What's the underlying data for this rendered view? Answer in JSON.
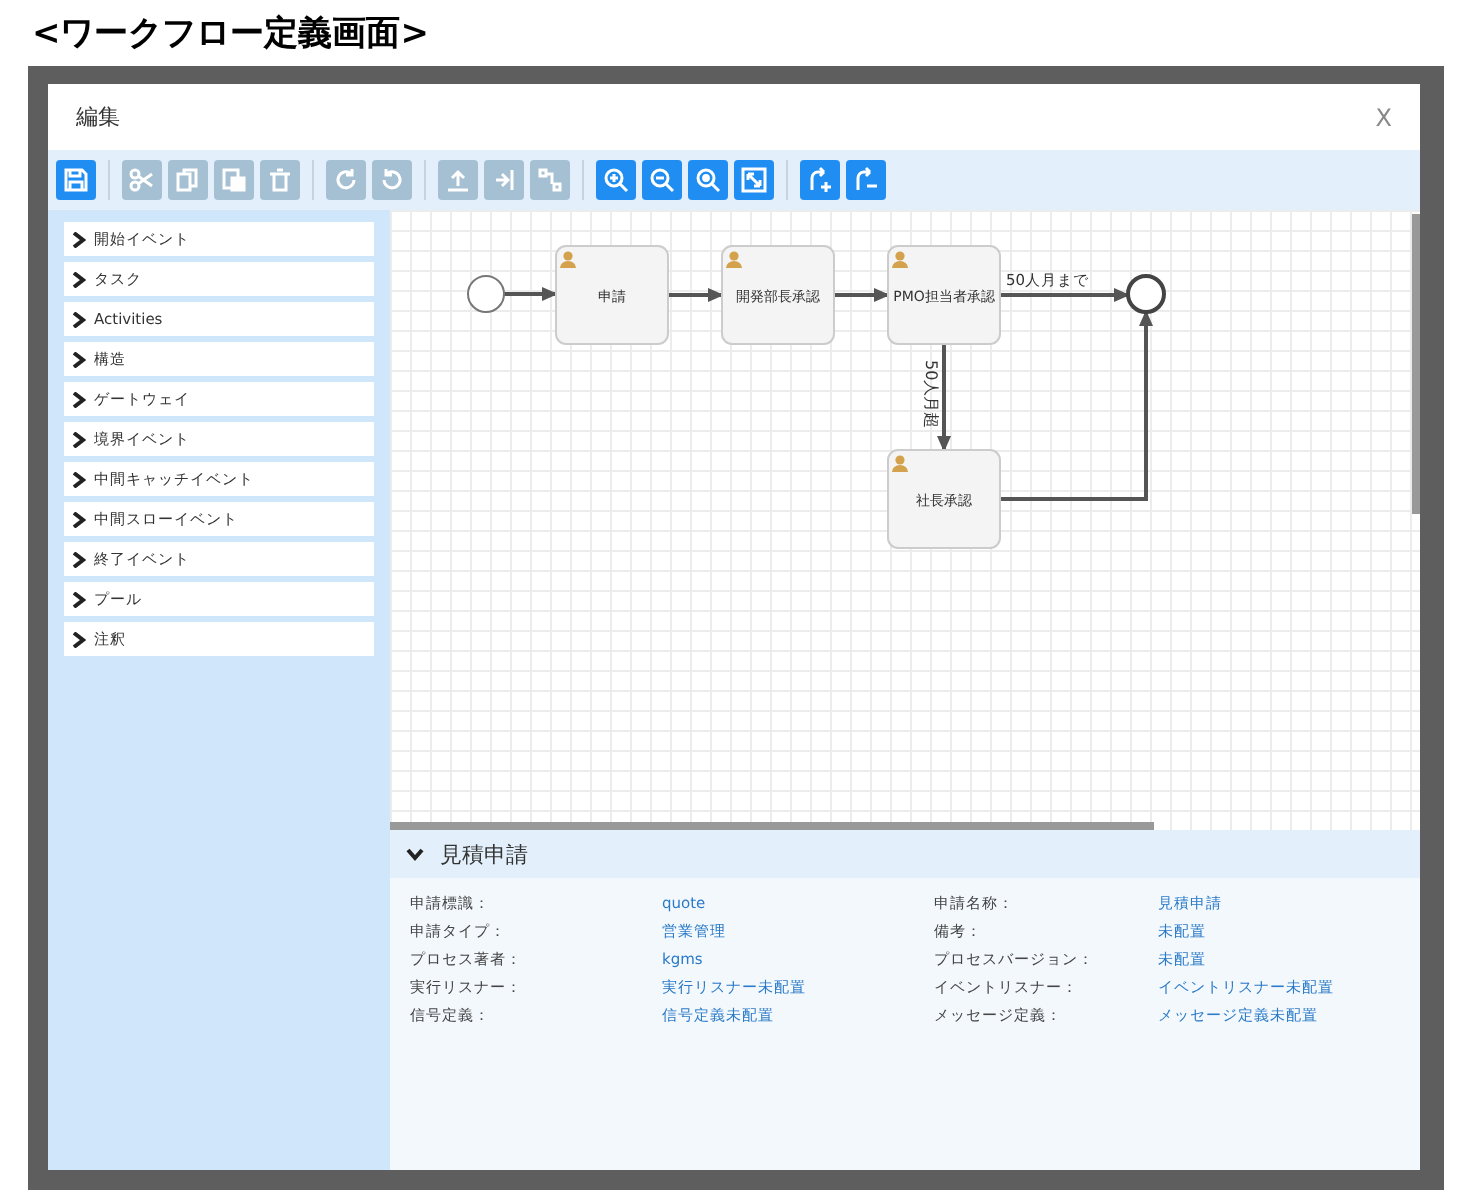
{
  "page_title": "<ワークフロー定義画面>",
  "dialog": {
    "title": "編集",
    "close": "X"
  },
  "toolbar": [
    {
      "kind": "save",
      "disabled": false
    },
    {
      "kind": "sep"
    },
    {
      "kind": "cut",
      "disabled": true
    },
    {
      "kind": "copy",
      "disabled": true
    },
    {
      "kind": "paste",
      "disabled": true
    },
    {
      "kind": "delete",
      "disabled": true
    },
    {
      "kind": "sep"
    },
    {
      "kind": "redo",
      "disabled": true
    },
    {
      "kind": "undo",
      "disabled": true
    },
    {
      "kind": "sep"
    },
    {
      "kind": "align-top",
      "disabled": true
    },
    {
      "kind": "align-side",
      "disabled": true
    },
    {
      "kind": "connect",
      "disabled": true
    },
    {
      "kind": "sep"
    },
    {
      "kind": "zoom-in",
      "disabled": false
    },
    {
      "kind": "zoom-out",
      "disabled": false
    },
    {
      "kind": "zoom-reset",
      "disabled": false
    },
    {
      "kind": "fit",
      "disabled": false
    },
    {
      "kind": "sep"
    },
    {
      "kind": "add-path",
      "disabled": false
    },
    {
      "kind": "remove-path",
      "disabled": false
    }
  ],
  "palette": [
    {
      "label": "開始イベント",
      "expanded": false
    },
    {
      "label": "タスク",
      "expanded": false
    },
    {
      "label": "Activities",
      "expanded": false
    },
    {
      "label": "構造",
      "expanded": false
    },
    {
      "label": "ゲートウェイ",
      "expanded": false
    },
    {
      "label": "境界イベント",
      "expanded": false
    },
    {
      "label": "中間キャッチイベント",
      "expanded": false
    },
    {
      "label": "中間スローイベント",
      "expanded": false
    },
    {
      "label": "終了イベント",
      "expanded": false
    },
    {
      "label": "プール",
      "expanded": false
    },
    {
      "label": "注釈",
      "expanded": false
    }
  ],
  "diagram": {
    "nodes": [
      {
        "kind": "start"
      },
      {
        "kind": "user_task",
        "label": "申請"
      },
      {
        "kind": "user_task",
        "label": "開発部長承認"
      },
      {
        "kind": "user_task",
        "label": "PMO担当者承認"
      },
      {
        "kind": "user_task",
        "label": "社長承認"
      },
      {
        "kind": "end"
      }
    ],
    "edge_labels": [
      {
        "text": "50人月まで"
      },
      {
        "text": "50人月超"
      }
    ]
  },
  "properties": {
    "title": "見積申請",
    "expanded": true,
    "fields": [
      {
        "label": "申請標識：",
        "value": "quote"
      },
      {
        "label": "申請名称：",
        "value": "見積申請"
      },
      {
        "label": "申請タイプ：",
        "value": "営業管理"
      },
      {
        "label": "備考：",
        "value": "未配置"
      },
      {
        "label": "プロセス著者：",
        "value": "kgms"
      },
      {
        "label": "プロセスバージョン：",
        "value": "未配置"
      },
      {
        "label": "実行リスナー：",
        "value": "実行リスナー未配置"
      },
      {
        "label": "イベントリスナー：",
        "value": "イベントリスナー未配置"
      },
      {
        "label": "信号定義：",
        "value": "信号定義未配置"
      },
      {
        "label": "メッセージ定義：",
        "value": "メッセージ定義未配置"
      }
    ]
  }
}
